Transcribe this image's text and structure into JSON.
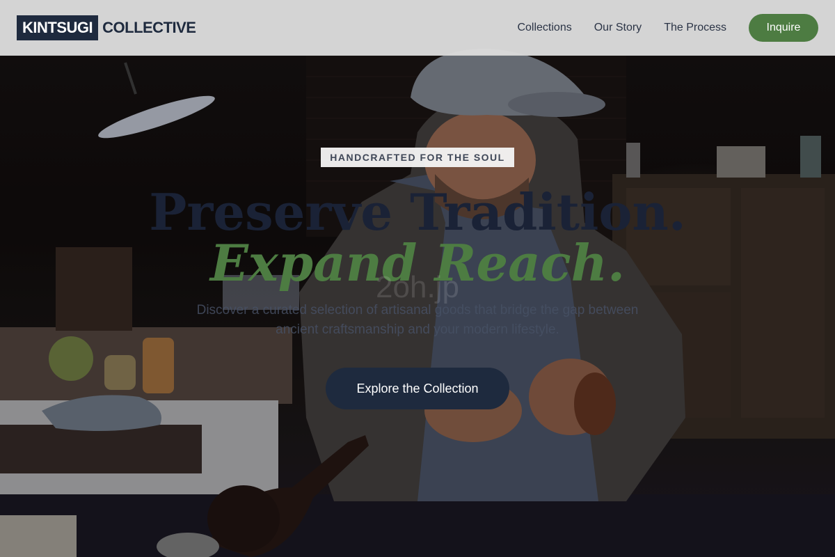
{
  "brand": {
    "mark": "KINTSUGI",
    "name": "COLLECTIVE"
  },
  "nav": {
    "items": [
      {
        "label": "Collections"
      },
      {
        "label": "Our Story"
      },
      {
        "label": "The Process"
      }
    ],
    "cta_label": "Inquire"
  },
  "hero": {
    "eyebrow": "HANDCRAFTED FOR THE SOUL",
    "headline_line1": "Preserve Tradition.",
    "headline_line2": "Expand Reach.",
    "watermark": "2oh.jp",
    "description": "Discover a curated selection of artisanal goods that bridge the gap between ancient craftsmanship and your modern lifestyle.",
    "cta_label": "Explore the Collection"
  },
  "colors": {
    "navy": "#1e2a3e",
    "green": "#4d7c42",
    "header_bg": "#dddddd"
  }
}
